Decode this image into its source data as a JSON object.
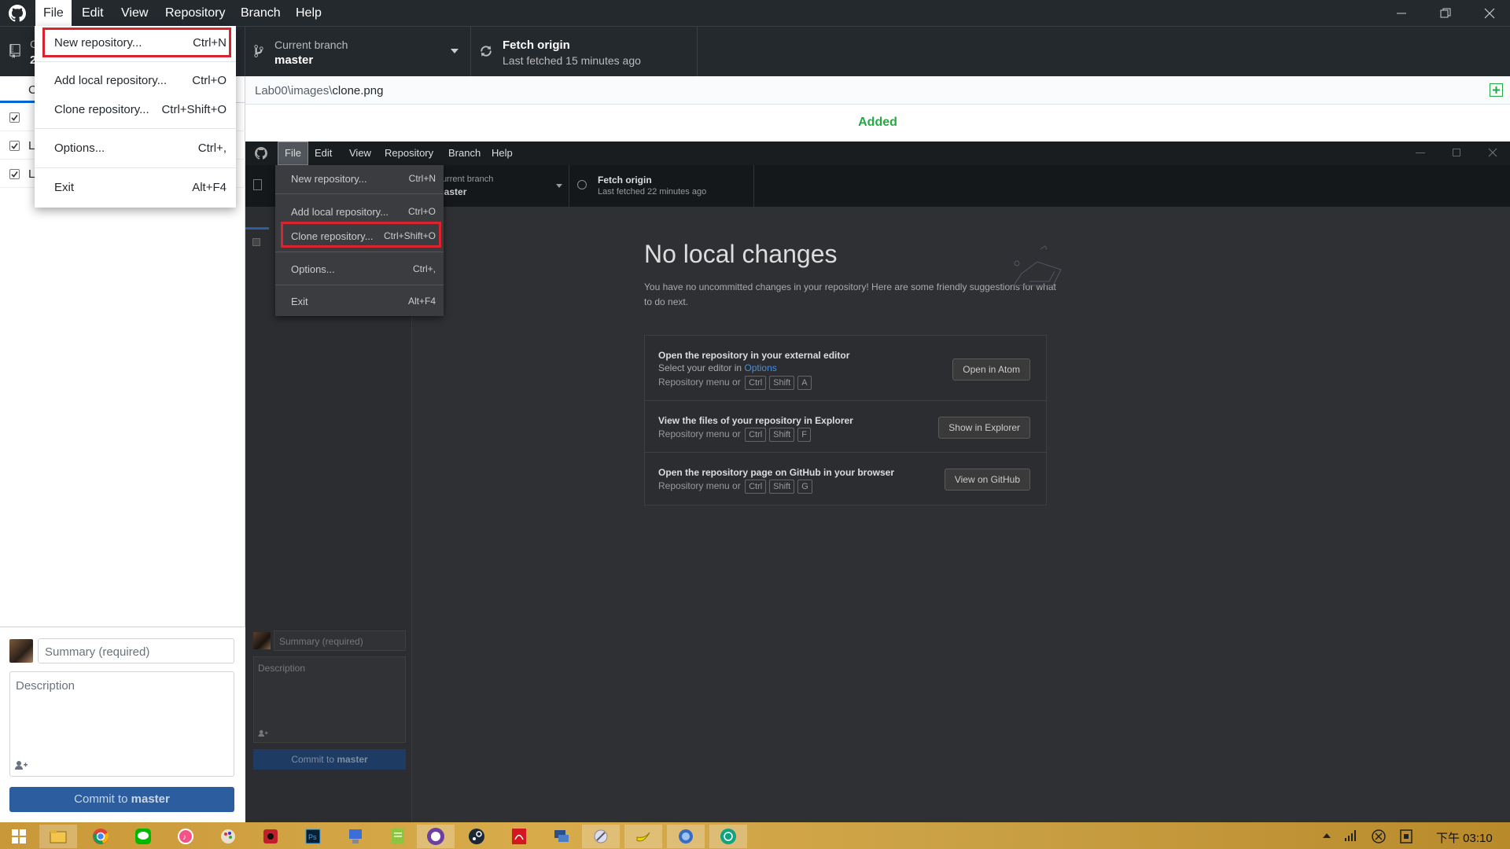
{
  "menubar": {
    "items": [
      "File",
      "Edit",
      "View",
      "Repository",
      "Branch",
      "Help"
    ]
  },
  "toolbar": {
    "repo_label_partial": "C",
    "repo_name_partial": "2",
    "branch_label": "Current branch",
    "branch_name": "master",
    "fetch_title": "Fetch origin",
    "fetch_sub": "Last fetched 15 minutes ago"
  },
  "sidebar": {
    "tab_partial": "C",
    "rows": [
      "",
      "L",
      "L"
    ],
    "summary_placeholder": "Summary (required)",
    "description_placeholder": "Description",
    "commit_prefix": "Commit to ",
    "commit_branch": "master"
  },
  "diff": {
    "file_prefix": "Lab00\\images\\",
    "file_name": "clone.png",
    "status": "Added"
  },
  "file_menu": {
    "items": [
      {
        "label": "New repository...",
        "shortcut": "Ctrl+N"
      },
      {
        "label": "Add local repository...",
        "shortcut": "Ctrl+O"
      },
      {
        "label": "Clone repository...",
        "shortcut": "Ctrl+Shift+O"
      },
      {
        "label": "Options...",
        "shortcut": "Ctrl+,"
      },
      {
        "label": "Exit",
        "shortcut": "Alt+F4"
      }
    ]
  },
  "inner": {
    "menubar": [
      "File",
      "Edit",
      "View",
      "Repository",
      "Branch",
      "Help"
    ],
    "toolbar": {
      "branch_label": "Current branch",
      "branch_name": "master",
      "fetch_title": "Fetch origin",
      "fetch_sub": "Last fetched 22 minutes ago"
    },
    "file_menu": {
      "items": [
        {
          "label": "New repository...",
          "shortcut": "Ctrl+N"
        },
        {
          "label": "Add local repository...",
          "shortcut": "Ctrl+O"
        },
        {
          "label": "Clone repository...",
          "shortcut": "Ctrl+Shift+O"
        },
        {
          "label": "Options...",
          "shortcut": "Ctrl+,"
        },
        {
          "label": "Exit",
          "shortcut": "Alt+F4"
        }
      ]
    },
    "no_changes": {
      "title": "No local changes",
      "desc": "You have no uncommitted changes in your repository! Here are some friendly suggestions for what to do next."
    },
    "suggestions": [
      {
        "title": "Open the repository in your external editor",
        "line2_prefix": "Select your editor in ",
        "line2_link": "Options",
        "hint_prefix": "Repository menu or",
        "keys": [
          "Ctrl",
          "Shift",
          "A"
        ],
        "button": "Open in Atom"
      },
      {
        "title": "View the files of your repository in Explorer",
        "hint_prefix": "Repository menu or",
        "keys": [
          "Ctrl",
          "Shift",
          "F"
        ],
        "button": "Show in Explorer"
      },
      {
        "title": "Open the repository page on GitHub in your browser",
        "hint_prefix": "Repository menu or",
        "keys": [
          "Ctrl",
          "Shift",
          "G"
        ],
        "button": "View on GitHub"
      }
    ],
    "summary_placeholder": "Summary (required)",
    "description_placeholder": "Description",
    "commit_prefix": "Commit to ",
    "commit_branch": "master"
  },
  "taskbar": {
    "clock": "下午 03:10"
  },
  "colors": {
    "app_dark": "#24292e",
    "highlight_red": "#d9232e",
    "added_green": "#28a745",
    "commit_blue": "#2c5d9e",
    "link_blue": "#4a90d9"
  }
}
